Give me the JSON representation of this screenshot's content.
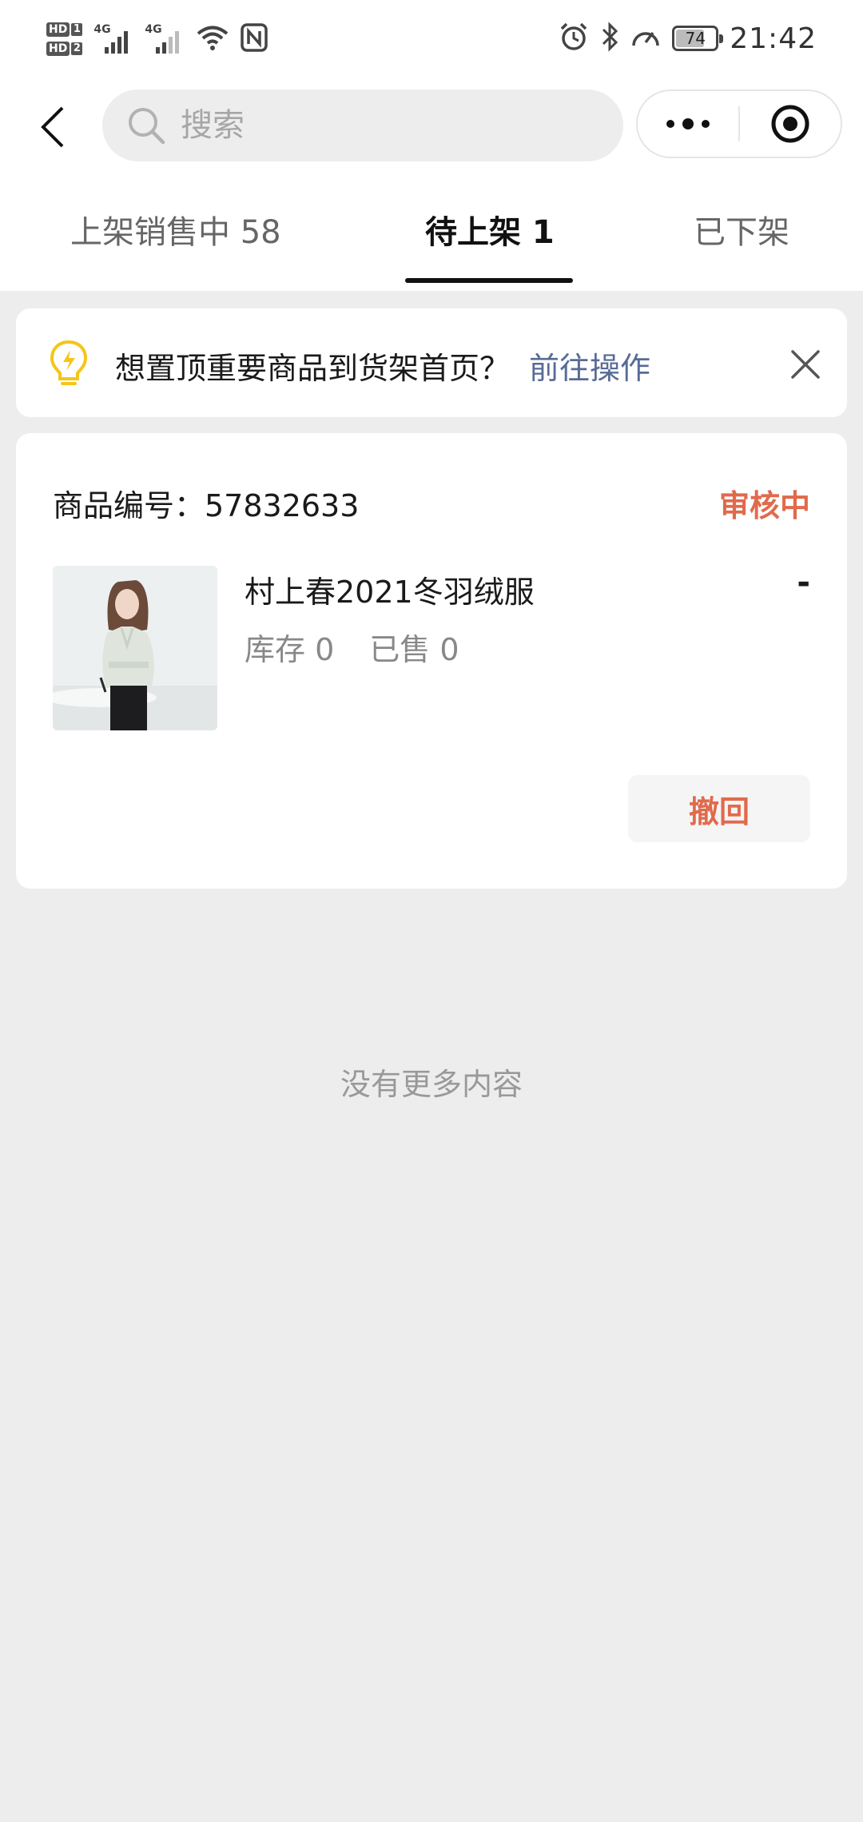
{
  "status_bar": {
    "sim1": "HD",
    "sim1_num": "1",
    "sim2": "HD",
    "sim2_num": "2",
    "net1": "4G",
    "net2": "4G",
    "battery": "74",
    "battery_level": 0.74,
    "time": "21:42"
  },
  "nav": {
    "search_placeholder": "搜索"
  },
  "tabs": [
    {
      "label": "上架销售中 58",
      "active": false
    },
    {
      "label": "待上架 1",
      "active": true
    },
    {
      "label": "已下架",
      "active": false
    }
  ],
  "notice": {
    "text": "想置顶重要商品到货架首页？",
    "link": "前往操作"
  },
  "product": {
    "id_label": "商品编号：57832633",
    "status": "审核中",
    "name": "村上春2021冬羽绒服",
    "price": "-",
    "stock": "库存 0",
    "sold": "已售 0",
    "action": "撤回"
  },
  "footer": {
    "no_more": "没有更多内容"
  },
  "colors": {
    "accent_orange": "#e06a4c",
    "link_blue": "#576b95",
    "bulb_yellow": "#f5c518",
    "background": "#ededed"
  }
}
